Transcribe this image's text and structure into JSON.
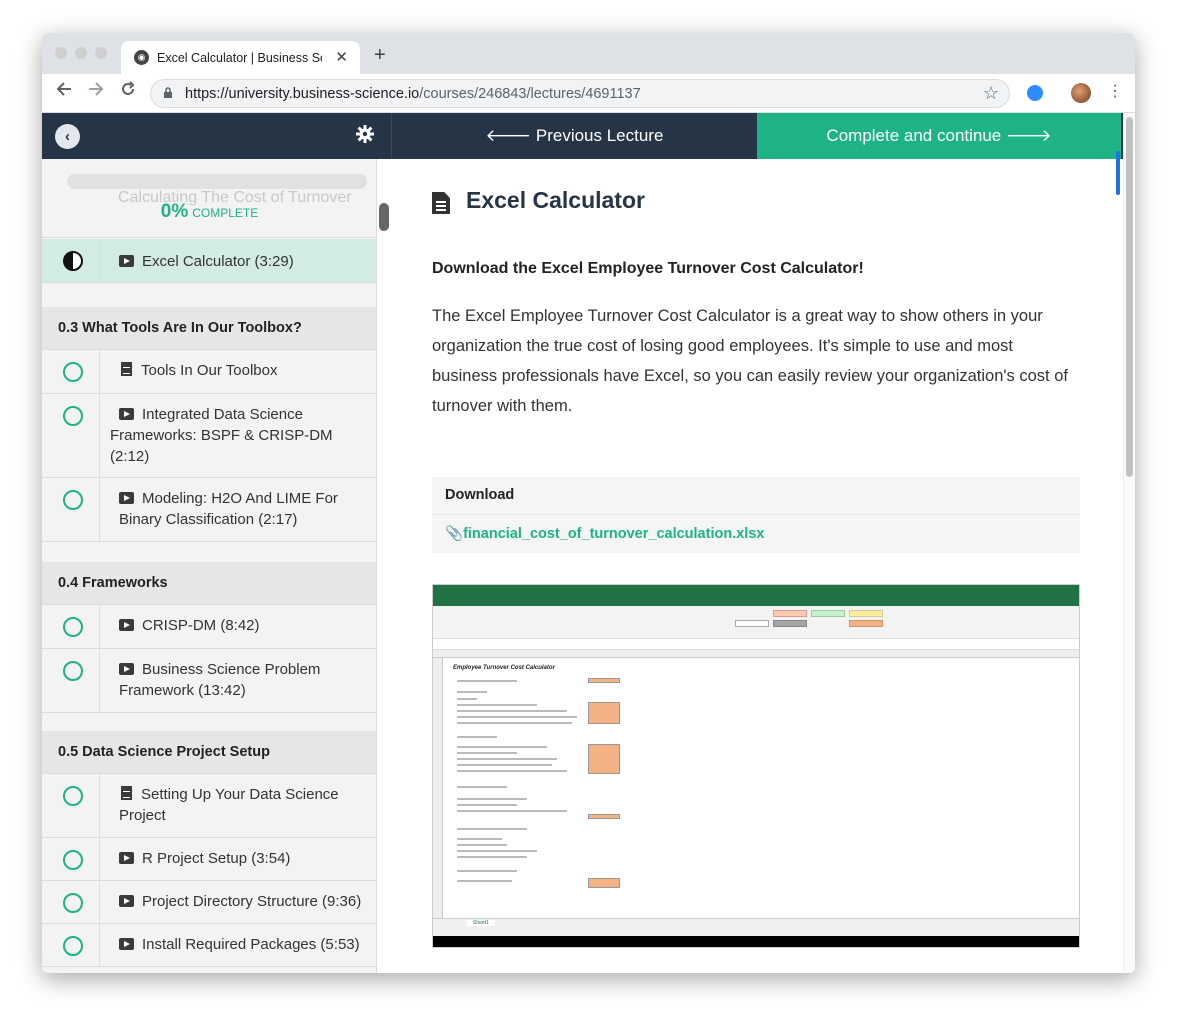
{
  "browser": {
    "tab_title": "Excel Calculator | Business Science",
    "new_tab": "+",
    "close": "✕",
    "url_host": "https://university.business-science.io",
    "url_path": "/courses/246843/lectures/4691137"
  },
  "topbar": {
    "prev_label": "Previous Lecture",
    "next_label": "Complete and continue"
  },
  "sidebar": {
    "progress_percent": "0%",
    "progress_label": "COMPLETE",
    "progress_value": 0,
    "ghost_item": "Calculating The Cost of Turnover",
    "current_item": "Excel Calculator (3:29)",
    "sections": [
      {
        "title": "0.3 What Tools Are In Our Toolbox?",
        "items": [
          {
            "type": "doc",
            "label": "Tools In Our Toolbox"
          },
          {
            "type": "video",
            "label": "Integrated Data Science Frameworks: BSPF & CRISP-DM (2:12)"
          },
          {
            "type": "video",
            "label": "Modeling: H2O And LIME For Binary Classification (2:17)"
          }
        ]
      },
      {
        "title": "0.4 Frameworks",
        "items": [
          {
            "type": "video",
            "label": "CRISP-DM (8:42)"
          },
          {
            "type": "video",
            "label": "Business Science Problem Framework (13:42)"
          }
        ]
      },
      {
        "title": "0.5 Data Science Project Setup",
        "items": [
          {
            "type": "doc",
            "label": "Setting Up Your Data Science Project"
          },
          {
            "type": "video",
            "label": "R Project Setup (3:54)"
          },
          {
            "type": "video",
            "label": "Project Directory Structure (9:36)"
          },
          {
            "type": "video",
            "label": "Install Required Packages (5:53)"
          }
        ]
      }
    ]
  },
  "main": {
    "title": "Excel Calculator",
    "subtitle": "Download the Excel Employee Turnover Cost Calculator!",
    "paragraph": "The Excel Employee Turnover Cost Calculator is a great way to show others in your organization the true cost of losing good employees. It's simple to use and most business professionals have Excel, so you can easily review your organization's cost of turnover with them.",
    "download_header": "Download",
    "download_file": "financial_cost_of_turnover_calculation.xlsx",
    "sheet_heading": "Employee Turnover Cost Calculator",
    "sheet_tab": "Sheet1"
  },
  "colors": {
    "accent": "#1db385",
    "header": "#263546",
    "excel_green": "#217346"
  }
}
